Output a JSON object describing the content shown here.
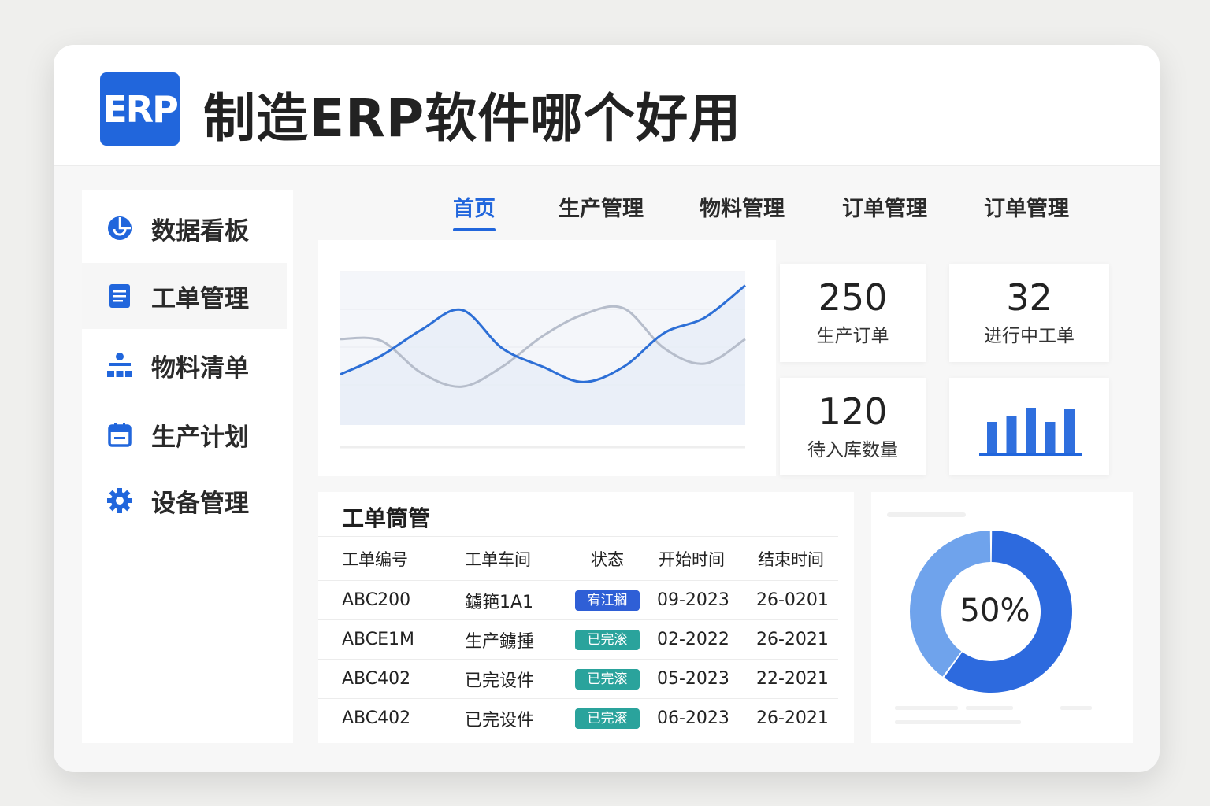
{
  "header": {
    "logo": "ERP",
    "title": "制造ERP软件哪个好用"
  },
  "sidebar": {
    "items": [
      {
        "label": "数据看板",
        "icon": "pie-chart-icon"
      },
      {
        "label": "工单管理",
        "icon": "document-icon",
        "active": true
      },
      {
        "label": "物料清单",
        "icon": "hierarchy-icon"
      },
      {
        "label": "生产计划",
        "icon": "calendar-icon"
      },
      {
        "label": "设备管理",
        "icon": "gear-icon"
      }
    ]
  },
  "tabs": [
    {
      "label": "首页",
      "active": true
    },
    {
      "label": "生产管理"
    },
    {
      "label": "物料管理"
    },
    {
      "label": "订单管理"
    },
    {
      "label": "订单管理"
    }
  ],
  "stats": [
    {
      "value": "250",
      "label": "生产订单"
    },
    {
      "value": "32",
      "label": "进行中工单"
    },
    {
      "value": "120",
      "label": "待入库数量"
    }
  ],
  "chart_data": [
    {
      "type": "line",
      "series": [
        {
          "name": "series-1",
          "color": "#2d6fd6",
          "values": [
            33,
            45,
            62,
            75,
            50,
            38,
            28,
            38,
            60,
            70,
            91
          ]
        },
        {
          "name": "series-2",
          "color": "#b6bdcb",
          "values": [
            56,
            55,
            34,
            25,
            38,
            58,
            72,
            76,
            50,
            40,
            56
          ]
        }
      ],
      "ylim": [
        0,
        100
      ]
    },
    {
      "type": "bar",
      "values": [
        40,
        48,
        58,
        40,
        56
      ],
      "color": "#2f6fde"
    },
    {
      "type": "pie",
      "label": "50%",
      "shares": [
        0.6,
        0.4
      ],
      "colors": [
        "#2d6ade",
        "#6fa3ec"
      ]
    }
  ],
  "table": {
    "title": "工单筒管",
    "headers": [
      "工单编号",
      "工单车间",
      "状态",
      "开始时间",
      "结束时间"
    ],
    "rows": [
      {
        "id": "ABC200",
        "shop": "鐪筢1A1",
        "status": "宥江搁",
        "status_color": "#2f5fd6",
        "start": "09-2023",
        "end": "26-0201"
      },
      {
        "id": "ABCE1M",
        "shop": "生产鐪揰",
        "status": "已完滚",
        "status_color": "#2aa39c",
        "start": "02-2022",
        "end": "26-2021"
      },
      {
        "id": "ABC402",
        "shop": "已完设件",
        "status": "已完滚",
        "status_color": "#2aa39c",
        "start": "05-2023",
        "end": "22-2021"
      },
      {
        "id": "ABC402",
        "shop": "已完设件",
        "status": "已完滚",
        "status_color": "#2aa39c",
        "start": "06-2023",
        "end": "26-2021"
      }
    ]
  }
}
